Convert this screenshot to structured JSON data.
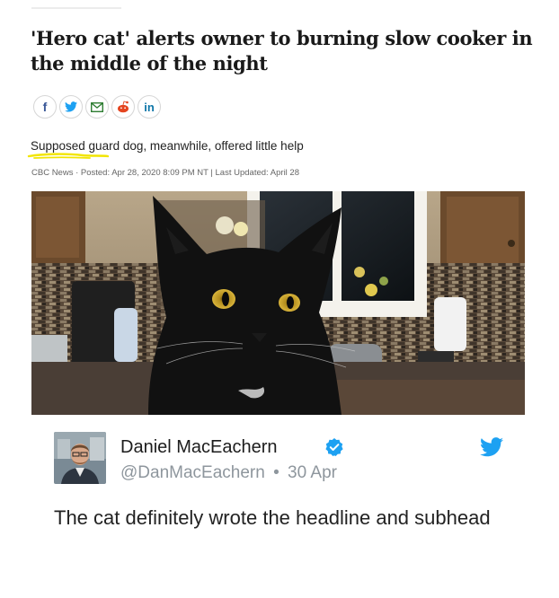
{
  "article": {
    "headline": "'Hero cat' alerts owner to burning slow cooker in the middle of the night",
    "subhead": "Supposed guard dog, meanwhile, offered little help",
    "meta": "CBC News · Posted: Apr 28, 2020 8:09 PM NT | Last Updated: April 28",
    "share_buttons": [
      {
        "icon": "facebook-icon",
        "glyph": "f",
        "color": "#3b5998"
      },
      {
        "icon": "twitter-icon",
        "glyph": "",
        "color": "#1da1f2"
      },
      {
        "icon": "email-icon",
        "glyph": "",
        "color": "#2e7d32"
      },
      {
        "icon": "reddit-icon",
        "glyph": "",
        "color": "#e4441f"
      },
      {
        "icon": "linkedin-icon",
        "glyph": "in",
        "color": "#0e76a8"
      }
    ],
    "highlight_color": "#f2e500"
  },
  "photo": {
    "alt_subject": "black-cat-photo"
  },
  "tweet": {
    "name": "Daniel MacEachern",
    "handle": "@DanMacEachern",
    "separator": "•",
    "date": "30 Apr",
    "text": "The cat definitely wrote the headline and subhead",
    "verified_color": "#1da1f2",
    "bird_color": "#1da1f2"
  }
}
